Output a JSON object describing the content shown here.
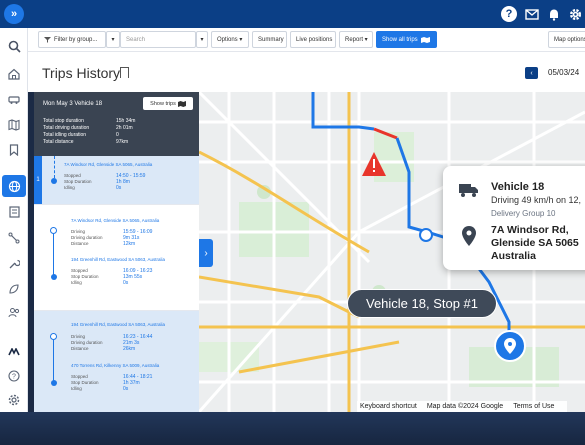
{
  "rail": {
    "expand_icon": "»"
  },
  "topnav": {
    "help": "?"
  },
  "toolbar": {
    "filter": "Filter by group...",
    "filter_caret": "▾",
    "search_placeholder": "Search",
    "search_caret": "▾",
    "options": "Options ▾",
    "summary": "Summary",
    "live": "Live positions",
    "report": "Report ▾",
    "show_all": "Show all trips",
    "map_options": "Map options"
  },
  "title": {
    "text": "Trips History",
    "prev": "‹",
    "date": "05/03/24"
  },
  "panel": {
    "header": "Mon May 3  Vehicle 18",
    "show_trips": "Show trips",
    "stats": [
      {
        "label": "Total stop duration",
        "value": "15h 34m"
      },
      {
        "label": "Total driving duration",
        "value": "2h 01m"
      },
      {
        "label": "Total idling duration",
        "value": "0"
      },
      {
        "label": "Total distance",
        "value": "97km"
      }
    ],
    "tab_number": "1",
    "stop1": {
      "address": "7A Windsor Rd, Glenside SA 5065, Australia",
      "labels": [
        "Stopped",
        "Stop Duration",
        "Idling"
      ],
      "values": [
        "14:50 - 15:59",
        "1h 8m",
        "0s"
      ]
    },
    "trip2": {
      "address": "7A Windsor Rd, Glenside SA 5065, Australia",
      "labels": [
        "Driving",
        "Driving duration",
        "Distance"
      ],
      "values": [
        "15:59 - 16:09",
        "9m 31s",
        "12km"
      ],
      "address2": "194 Greenhill Rd, Eastwood SA 5063, Australia",
      "labels2": [
        "Stopped",
        "Stop Duration",
        "Idling"
      ],
      "values2": [
        "16:09 - 16:23",
        "13m 55s",
        "0s"
      ]
    },
    "trip3": {
      "address": "194 Greenhill Rd, Eastwood SA 5063, Australia",
      "labels": [
        "Driving",
        "Driving duration",
        "Distance"
      ],
      "values": [
        "16:23 - 16:44",
        "21m 3s",
        "26km"
      ],
      "address2": "470 Torrens Rd, Kilkenny SA 5009, Australia",
      "labels2": [
        "Stopped",
        "Stop Duration",
        "Idling"
      ],
      "values2": [
        "16:44 - 18:21",
        "1h 37m",
        "0s"
      ]
    },
    "collapse": "›"
  },
  "map": {
    "card": {
      "title": "Vehicle 18",
      "status": "Driving 49 km/h on 12,",
      "group": "Delivery Group 10",
      "address": "7A Windsor Rd, Glenside SA 5065 Australia"
    },
    "tooltip": "Vehicle 18, Stop #1",
    "attribution": [
      "Keyboard shortcut",
      "Map data ©2024 Google",
      "Terms of Use"
    ],
    "route_color": "#1e77e6",
    "alert_color": "#e8352b"
  }
}
